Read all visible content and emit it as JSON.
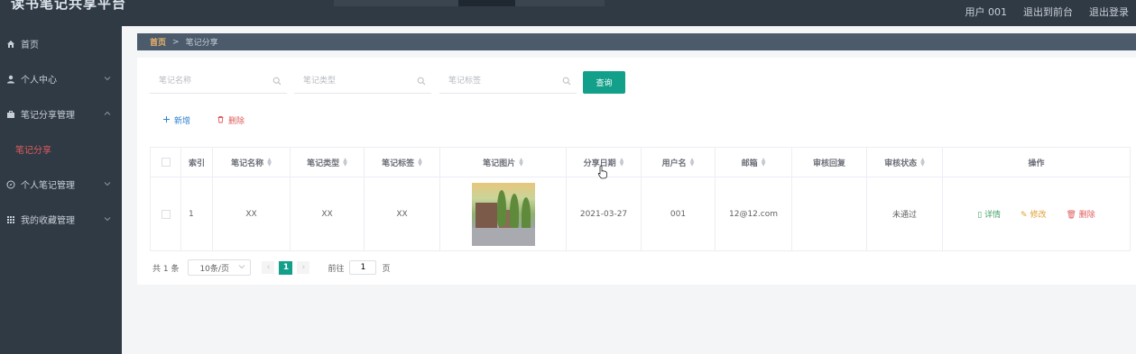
{
  "app": {
    "title": "读书笔记共享平台"
  },
  "topnav": {
    "user": "用户 001",
    "front": "退出到前台",
    "logout": "退出登录"
  },
  "sidebar": {
    "items": [
      {
        "label": "首页"
      },
      {
        "label": "个人中心"
      },
      {
        "label": "笔记分享管理"
      },
      {
        "label": "个人笔记管理"
      },
      {
        "label": "我的收藏管理"
      }
    ],
    "active_sub": "笔记分享"
  },
  "breadcrumb": {
    "home": "首页",
    "separator": ">",
    "current": "笔记分享"
  },
  "search": {
    "name_placeholder": "笔记名称",
    "type_placeholder": "笔记类型",
    "tag_placeholder": "笔记标签",
    "query_label": "查询"
  },
  "actions": {
    "add_label": "新增",
    "delete_label": "删除"
  },
  "table": {
    "columns": [
      "索引",
      "笔记名称",
      "笔记类型",
      "笔记标签",
      "笔记图片",
      "分享日期",
      "用户名",
      "邮箱",
      "审核回复",
      "审核状态",
      "操作"
    ],
    "rows": [
      {
        "index": "1",
        "name": "XX",
        "type": "XX",
        "tag": "XX",
        "date": "2021-03-27",
        "username": "001",
        "email": "12@12.com",
        "reply": "",
        "status": "未通过"
      }
    ],
    "ops": {
      "detail": "详情",
      "edit": "修改",
      "delete": "删除"
    }
  },
  "pagination": {
    "total": "共 1 条",
    "page_size": "10条/页",
    "current_page": "1",
    "goto_prefix": "前往",
    "goto_value": "1",
    "goto_suffix": "页"
  },
  "colors": {
    "primary": "#13a08a",
    "sidebar_bg": "#2f3a45",
    "danger": "#e05c5c",
    "link": "#2b7fd0"
  }
}
